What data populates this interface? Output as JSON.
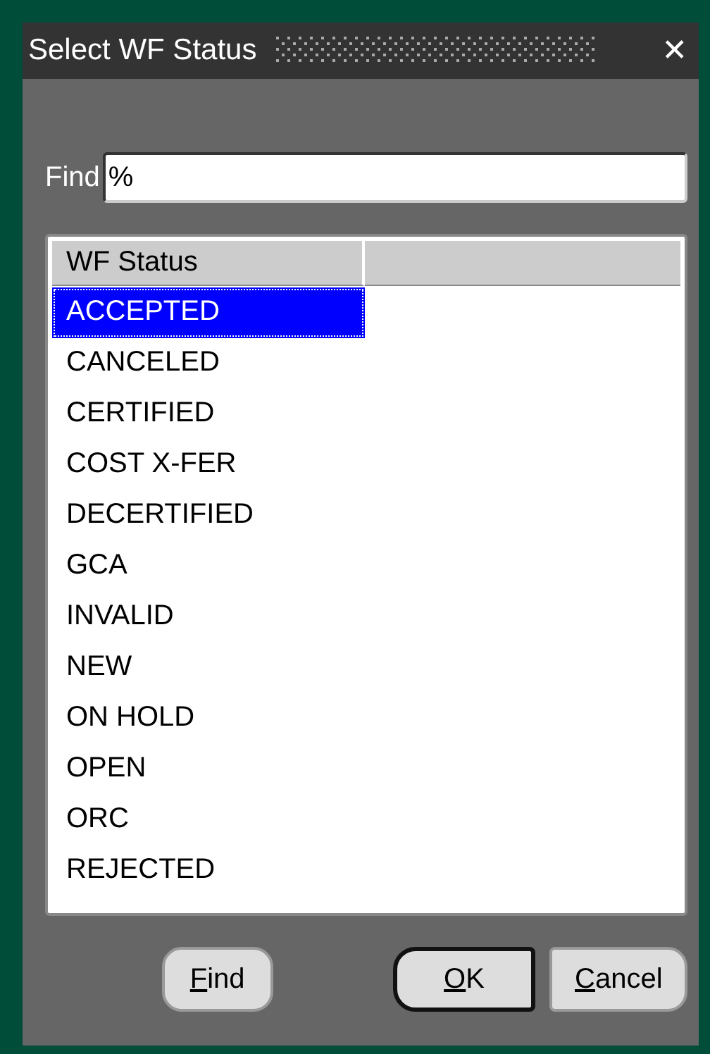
{
  "window": {
    "title": "Select WF Status",
    "close": "✕"
  },
  "find": {
    "label": "Find",
    "value": "%"
  },
  "table": {
    "columns": [
      "WF Status"
    ],
    "rows": [
      {
        "value": "ACCEPTED",
        "selected": true
      },
      {
        "value": "CANCELED",
        "selected": false
      },
      {
        "value": "CERTIFIED",
        "selected": false
      },
      {
        "value": "COST X-FER",
        "selected": false
      },
      {
        "value": "DECERTIFIED",
        "selected": false
      },
      {
        "value": "GCA",
        "selected": false
      },
      {
        "value": "INVALID",
        "selected": false
      },
      {
        "value": "NEW",
        "selected": false
      },
      {
        "value": "ON HOLD",
        "selected": false
      },
      {
        "value": "OPEN",
        "selected": false
      },
      {
        "value": "ORC",
        "selected": false
      },
      {
        "value": "REJECTED",
        "selected": false
      }
    ]
  },
  "buttons": [
    {
      "label": "Find",
      "default": false
    },
    {
      "label": "OK",
      "default": true
    },
    {
      "label": "Cancel",
      "default": false
    }
  ]
}
